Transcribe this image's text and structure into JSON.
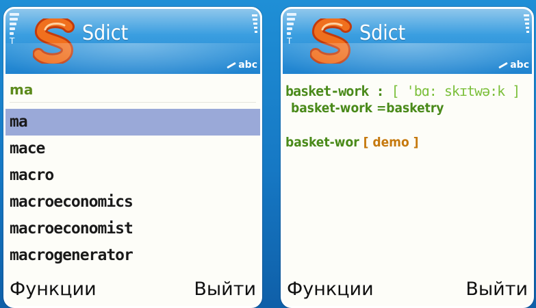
{
  "screens": [
    {
      "app_title": "Sdict",
      "input_mode": "abc",
      "search_value": "ma",
      "word_list": [
        {
          "word": "ma",
          "selected": true
        },
        {
          "word": "mace",
          "selected": false
        },
        {
          "word": "macro",
          "selected": false
        },
        {
          "word": "macroeconomics",
          "selected": false
        },
        {
          "word": "macroeconomist",
          "selected": false
        },
        {
          "word": "macrogenerator",
          "selected": false
        }
      ],
      "softkeys": {
        "left": "Функции",
        "right": "Выйти"
      }
    },
    {
      "app_title": "Sdict",
      "input_mode": "abc",
      "entry": {
        "headword": "basket-work :",
        "transcription": "[ 'bɑ: skɪtwə:k ]",
        "definition": "basket-work =basketry",
        "demo_word": "basket-wor",
        "demo_tag": "[ demo ]"
      },
      "softkeys": {
        "left": "Функции",
        "right": "Выйти"
      }
    }
  ],
  "colors": {
    "background": "#1678c4",
    "header": "#1f83cf",
    "selection": "#9aa9d8",
    "entry_text": "#4a8a1a",
    "transcription": "#7bbf3a",
    "logo": "#e85a1a"
  },
  "icons": [
    "signal-strength-icon",
    "sdict-logo-icon",
    "pen-input-icon",
    "battery-icon"
  ]
}
